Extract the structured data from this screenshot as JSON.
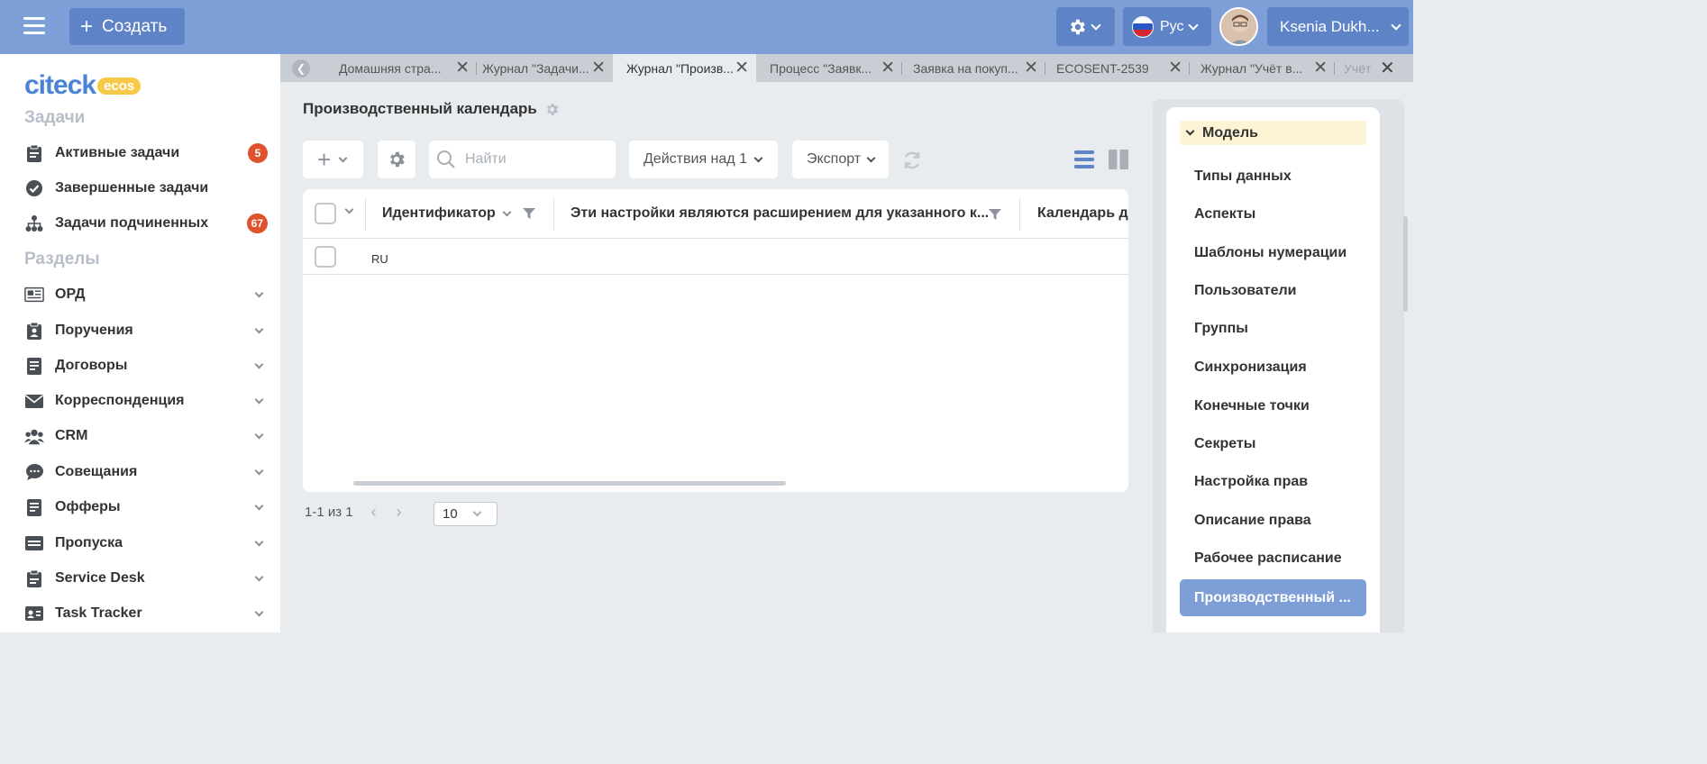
{
  "topbar": {
    "create_label": "Создать",
    "lang_label": "Рус",
    "user_name": "Ksenia Dukh..."
  },
  "sidebar": {
    "logo_text": "citeck",
    "logo_badge": "ecos",
    "section_tasks": "Задачи",
    "tasks": [
      {
        "label": "Активные задачи",
        "badge": "5"
      },
      {
        "label": "Завершенные задачи",
        "badge": ""
      },
      {
        "label": "Задачи подчиненных",
        "badge": "67"
      }
    ],
    "section_sections": "Разделы",
    "sections": [
      {
        "label": "ОРД"
      },
      {
        "label": "Поручения"
      },
      {
        "label": "Договоры"
      },
      {
        "label": "Корреспонденция"
      },
      {
        "label": "CRM"
      },
      {
        "label": "Совещания"
      },
      {
        "label": "Офферы"
      },
      {
        "label": "Пропуска"
      },
      {
        "label": "Service Desk"
      },
      {
        "label": "Task Tracker"
      }
    ]
  },
  "tabs": [
    {
      "label": "Домашняя стра...",
      "active": false
    },
    {
      "label": "Журнал \"Задачи...",
      "active": false
    },
    {
      "label": "Журнал \"Произв...",
      "active": true
    },
    {
      "label": "Процесс \"Заявк...",
      "active": false
    },
    {
      "label": "Заявка на покуп...",
      "active": false
    },
    {
      "label": "ECOSENT-2539",
      "active": false
    },
    {
      "label": "Журнал \"Учёт в...",
      "active": false
    },
    {
      "label": "Учёт",
      "active": false
    }
  ],
  "main": {
    "title": "Производственный календарь",
    "search_placeholder": "Найти",
    "actions_label": "Действия над 1",
    "export_label": "Экспорт",
    "columns": [
      "Идентификатор",
      "Эти настройки являются расширением для указанного к...",
      "Календарь де"
    ],
    "rows": [
      {
        "id": "RU"
      }
    ],
    "pager_text": "1-1 из 1",
    "page_size": "10"
  },
  "right_panel": {
    "head": "Модель",
    "items": [
      "Типы данных",
      "Аспекты",
      "Шаблоны нумерации",
      "Пользователи",
      "Группы",
      "Синхронизация",
      "Конечные точки",
      "Секреты",
      "Настройка прав",
      "Описание права",
      "Рабочее расписание"
    ],
    "active_item": "Производственный ..."
  }
}
